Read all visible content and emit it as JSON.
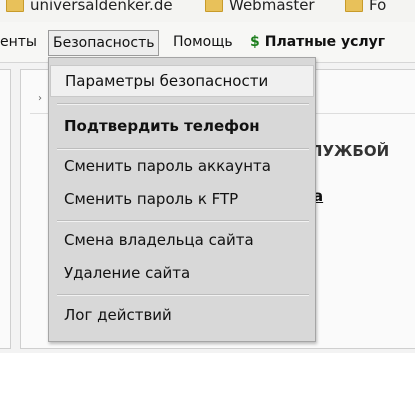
{
  "bookmarks": [
    {
      "label": "universaldenker.de",
      "icon": "folder-icon"
    },
    {
      "label": "Webmaster",
      "icon": "folder-icon"
    },
    {
      "label": "Fo",
      "icon": "folder-icon"
    }
  ],
  "menubar": {
    "items": [
      "енты",
      "Безопасность",
      "Помощь"
    ],
    "paid_label": "Платные услуг",
    "paid_icon_glyph": "$"
  },
  "background": {
    "heading": "ЛУЖБОЙ",
    "link": "a"
  },
  "dropdown": {
    "items": [
      {
        "label": "Параметры безопасности"
      },
      {
        "label": "Подтвердить телефон"
      },
      {
        "label": "Сменить пароль аккаунта"
      },
      {
        "label": "Сменить пароль к FTP"
      },
      {
        "label": "Смена владельца сайта"
      },
      {
        "label": "Удаление сайта"
      },
      {
        "label": "Лог действий"
      }
    ]
  },
  "colors": {
    "accent_dollar": "#1e7f1e",
    "menu_bg": "#d8d8d8"
  }
}
